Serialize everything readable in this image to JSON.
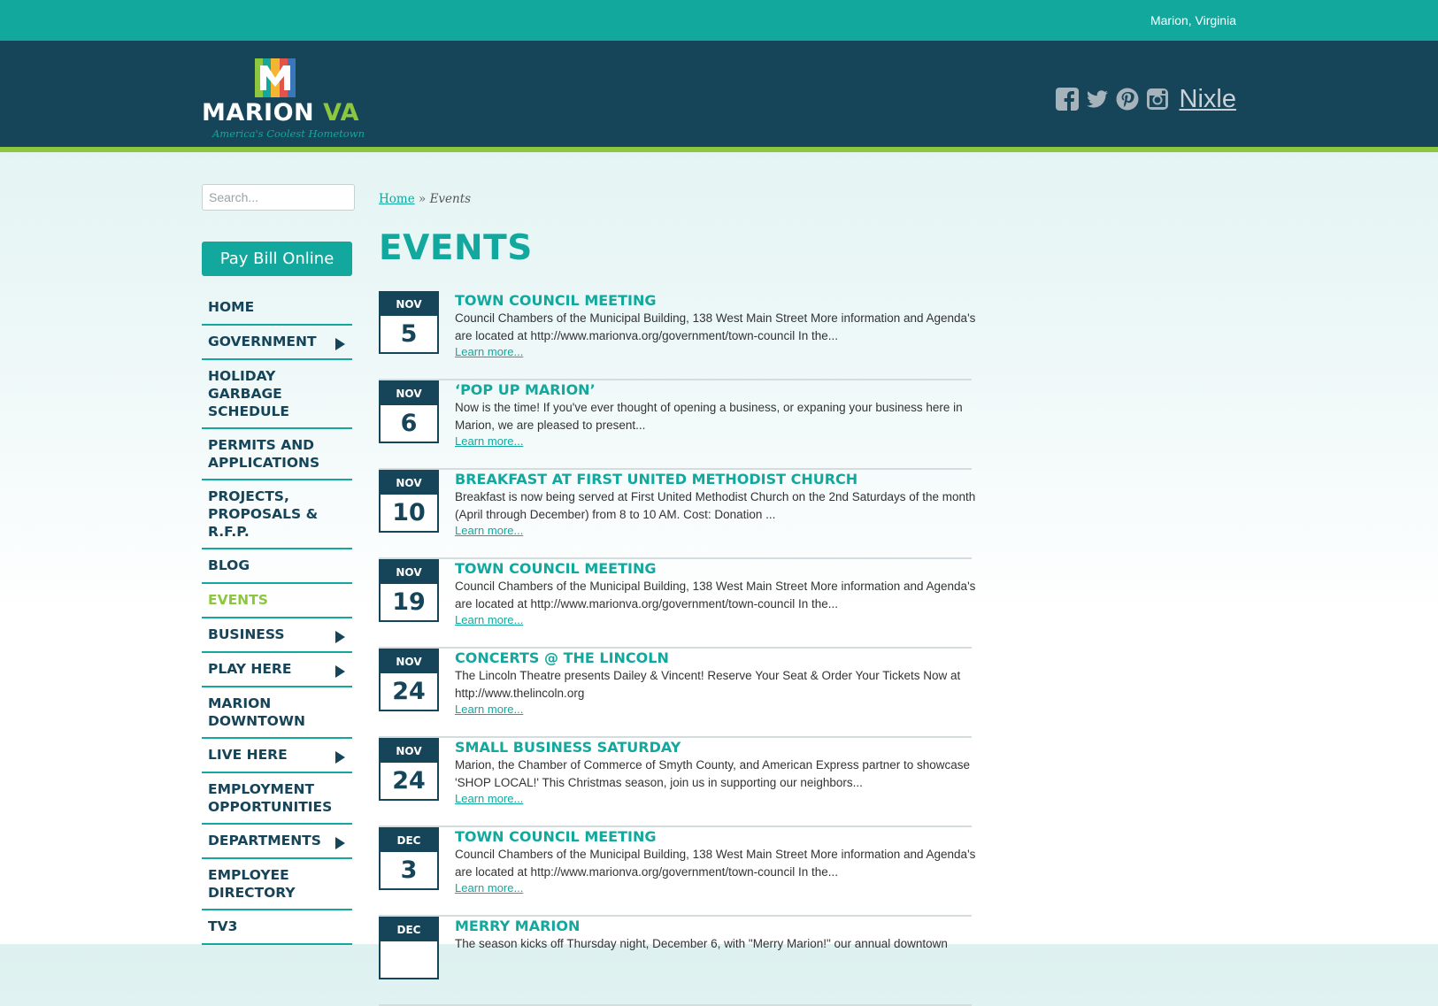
{
  "topbar": {
    "location": "Marion, Virginia"
  },
  "header": {
    "logo_name": "MARION",
    "logo_state": "VA",
    "logo_tagline": "America's Coolest Hometown",
    "social": [
      {
        "icon": "facebook-icon"
      },
      {
        "icon": "twitter-icon"
      },
      {
        "icon": "pinterest-icon"
      },
      {
        "icon": "instagram-icon"
      }
    ],
    "nixle_label": "Nixle"
  },
  "sidebar": {
    "search_placeholder": "Search...",
    "pay_bill_label": "Pay Bill Online",
    "nav": [
      {
        "label": "Home",
        "submenu": false
      },
      {
        "label": "Government",
        "submenu": true
      },
      {
        "label": "Holiday Garbage Schedule",
        "submenu": false
      },
      {
        "label": "Permits and Applications",
        "submenu": false
      },
      {
        "label": "Projects, Proposals & R.F.P.",
        "submenu": false
      },
      {
        "label": "Blog",
        "submenu": false
      },
      {
        "label": "Events",
        "submenu": false,
        "active": true
      },
      {
        "label": "Business",
        "submenu": true
      },
      {
        "label": "Play Here",
        "submenu": true
      },
      {
        "label": "Marion Downtown",
        "submenu": false
      },
      {
        "label": "Live Here",
        "submenu": true
      },
      {
        "label": "Employment Opportunities",
        "submenu": false
      },
      {
        "label": "Departments",
        "submenu": true
      },
      {
        "label": "Employee Directory",
        "submenu": false
      },
      {
        "label": "TV3",
        "submenu": false
      }
    ]
  },
  "breadcrumb": {
    "home": "Home",
    "separator": "»",
    "current": "Events"
  },
  "main": {
    "title": "EVENTS",
    "learn_more": "Learn more...",
    "events": [
      {
        "month": "NOV",
        "day": "5",
        "title": "Town Council Meeting",
        "desc": "Council Chambers of the Municipal Building, 138 West Main Street More information and Agenda's are located at http://www.marionva.org/government/town-council In the..."
      },
      {
        "month": "NOV",
        "day": "6",
        "title": "‘Pop Up Marion’",
        "desc": "Now is the time! If you've ever thought of opening a business, or expaning your business here in Marion, we are pleased to present..."
      },
      {
        "month": "NOV",
        "day": "10",
        "title": "Breakfast at First United Methodist Church",
        "desc": "Breakfast is now being served at First United Methodist Church on the 2nd Saturdays of the month (April through December) from 8 to 10 AM. Cost: Donation ..."
      },
      {
        "month": "NOV",
        "day": "19",
        "title": "Town Council Meeting",
        "desc": "Council Chambers of the Municipal Building, 138 West Main Street More information and Agenda's are located at http://www.marionva.org/government/town-council In the..."
      },
      {
        "month": "NOV",
        "day": "24",
        "title": "Concerts @ The Lincoln",
        "desc": "The Lincoln Theatre presents Dailey & Vincent! Reserve Your Seat & Order Your Tickets Now at http://www.thelincoln.org"
      },
      {
        "month": "NOV",
        "day": "24",
        "title": "Small Business Saturday",
        "desc": "Marion, the Chamber of Commerce of Smyth County, and American Express partner to showcase 'SHOP LOCAL!' This Christmas season, join us in supporting our neighbors..."
      },
      {
        "month": "DEC",
        "day": "3",
        "title": "Town Council Meeting",
        "desc": "Council Chambers of the Municipal Building, 138 West Main Street More information and Agenda's are located at http://www.marionva.org/government/town-council In the..."
      },
      {
        "month": "DEC",
        "day": "",
        "title": "Merry Marion",
        "desc": "The season kicks off Thursday night, December 6, with \"Merry Marion!\" our annual downtown"
      }
    ]
  },
  "colors": {
    "teal": "#13a89e",
    "navy": "#164459",
    "green": "#8dc63f"
  }
}
